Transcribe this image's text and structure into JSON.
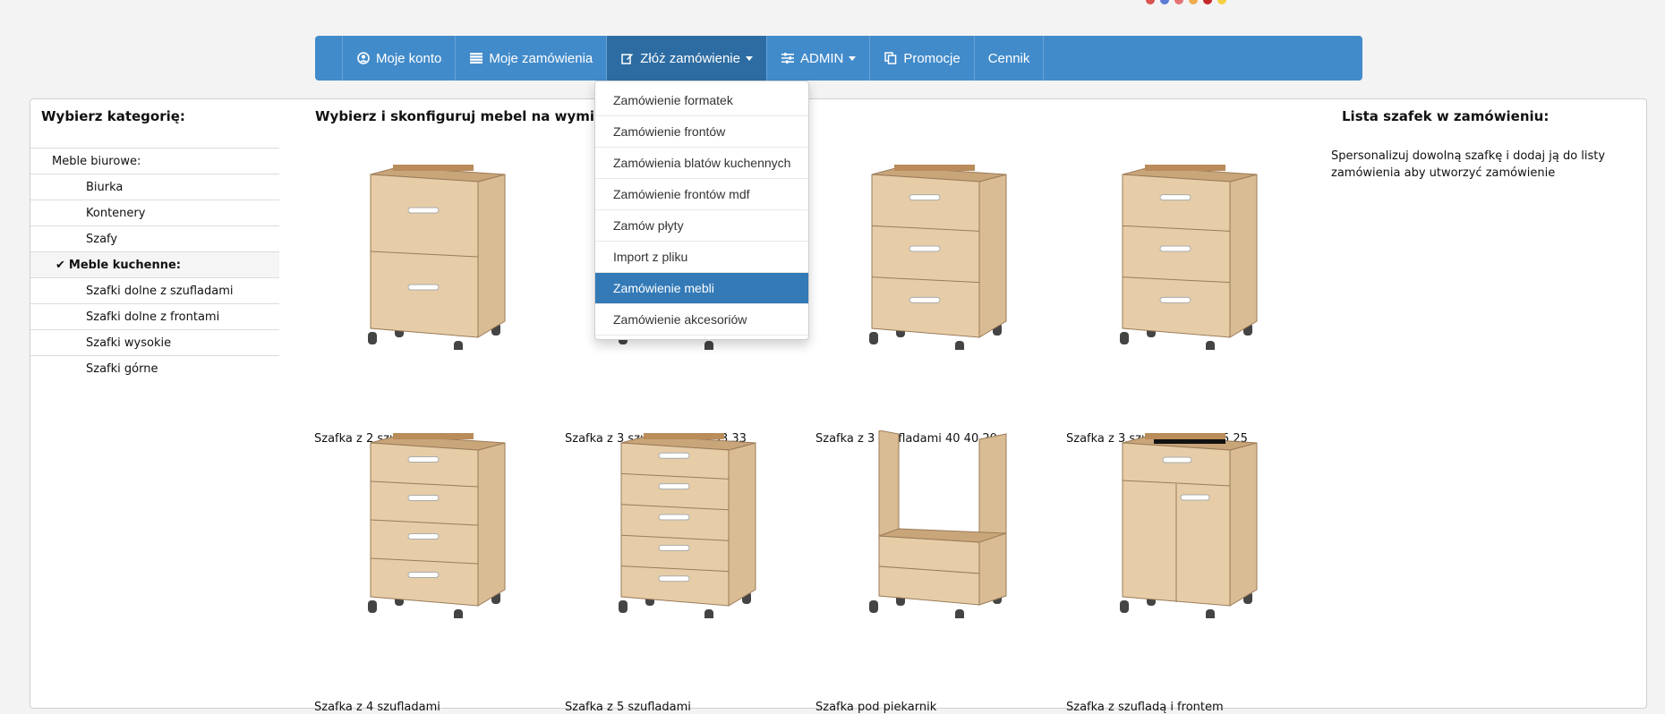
{
  "colors": {
    "navbar": "#428bca",
    "navbar_active": "#2d6ca2",
    "dropdown_active": "#337ab7",
    "wood": "#e6cda8"
  },
  "navbar": {
    "items": [
      {
        "label": "Moje konto",
        "icon": "user-circle-icon"
      },
      {
        "label": "Moje zamówienia",
        "icon": "list-icon"
      },
      {
        "label": "Złóż zamówienie",
        "icon": "edit-icon",
        "active": true,
        "dropdown": true
      },
      {
        "label": "ADMIN",
        "icon": "sliders-icon",
        "dropdown": true
      },
      {
        "label": "Promocje",
        "icon": "copy-icon"
      },
      {
        "label": "Cennik"
      }
    ]
  },
  "dropdown": {
    "items": [
      "Zamówienie formatek",
      "Zamówienie frontów",
      "Zamówienia blatów kuchennych",
      "Zamówienie frontów mdf",
      "Zamów płyty",
      "Import z pliku",
      "Zamówienie mebli",
      "Zamówienie akcesoriów"
    ],
    "active_index": 6
  },
  "sidebar": {
    "title": "Wybierz kategorię:",
    "items": [
      {
        "label": "Meble biurowe:",
        "level": "group"
      },
      {
        "label": "Biurka",
        "level": "sub"
      },
      {
        "label": "Kontenery",
        "level": "sub"
      },
      {
        "label": "Szafy",
        "level": "sub"
      },
      {
        "label": "Meble kuchenne:",
        "level": "group",
        "selected": true
      },
      {
        "label": "Szafki dolne z szufladami",
        "level": "sub"
      },
      {
        "label": "Szafki dolne z frontami",
        "level": "sub"
      },
      {
        "label": "Szafki wysokie",
        "level": "sub"
      },
      {
        "label": "Szafki górne",
        "level": "sub"
      }
    ]
  },
  "main": {
    "title": "Wybierz i skonfiguruj mebel na wymiar:",
    "products": [
      {
        "name": "Szafka z 2 szufladami",
        "drawers": 2
      },
      {
        "name": "Szafka z 3 szufladami 34 33 33",
        "drawers": 3
      },
      {
        "name": "Szafka z 3 szufladami 40 40 20",
        "drawers": 3
      },
      {
        "name": "Szafka z 3 szufladami 50 25 25",
        "drawers": 3
      },
      {
        "name": "Szafka z 4 szufladami",
        "drawers": 4
      },
      {
        "name": "Szafka z 5 szufladami",
        "drawers": 5
      },
      {
        "name": "Szafka pod piekarnik",
        "drawers": 0
      },
      {
        "name": "Szafka z szufladą i frontem",
        "drawers": 1
      }
    ]
  },
  "order_list": {
    "title": "Lista szafek w zamówieniu:",
    "text": "Spersonalizuj dowolną szafkę i dodaj ją do listy zamówienia aby utworzyć zamówienie"
  }
}
